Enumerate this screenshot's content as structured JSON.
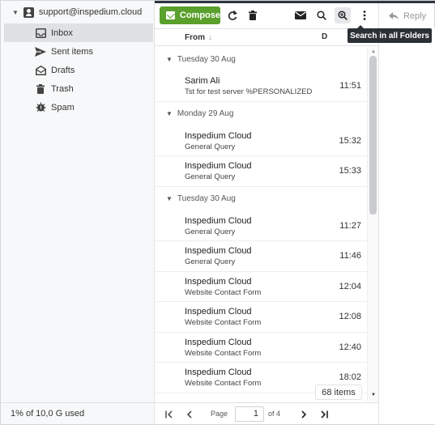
{
  "account": {
    "email": "support@inspedium.cloud"
  },
  "folders": [
    {
      "label": "Inbox",
      "icon": "inbox-icon",
      "active": true
    },
    {
      "label": "Sent items",
      "icon": "send-icon",
      "active": false
    },
    {
      "label": "Drafts",
      "icon": "drafts-icon",
      "active": false
    },
    {
      "label": "Trash",
      "icon": "trash-icon",
      "active": false
    },
    {
      "label": "Spam",
      "icon": "spam-icon",
      "active": false
    }
  ],
  "quota": "1% of 10,0 G used",
  "toolbar": {
    "compose_label": "Compose",
    "reply_label": "Reply",
    "tooltip": "Search in all Folders"
  },
  "list": {
    "from_header": "From",
    "sort_arrow": "↓",
    "date_header": "D",
    "groups": [
      {
        "label": "Tuesday 30 Aug",
        "messages": [
          {
            "from": "Sarim Ali",
            "subject": "Tst for test server %PERSONALIZED",
            "time": "11:51"
          }
        ]
      },
      {
        "label": "Monday 29 Aug",
        "messages": [
          {
            "from": "Inspedium Cloud",
            "subject": "General Query",
            "time": "15:32"
          },
          {
            "from": "Inspedium Cloud",
            "subject": "General Query",
            "time": "15:33"
          }
        ]
      },
      {
        "label": "Tuesday 30 Aug",
        "messages": [
          {
            "from": "Inspedium Cloud",
            "subject": "General Query",
            "time": "11:27"
          },
          {
            "from": "Inspedium Cloud",
            "subject": "General Query",
            "time": "11:46"
          },
          {
            "from": "Inspedium Cloud",
            "subject": "Website Contact Form",
            "time": "12:04"
          },
          {
            "from": "Inspedium Cloud",
            "subject": "Website Contact Form",
            "time": "12:08"
          },
          {
            "from": "Inspedium Cloud",
            "subject": "Website Contact Form",
            "time": "12:40"
          },
          {
            "from": "Inspedium Cloud",
            "subject": "Website Contact Form",
            "time": "18:02"
          }
        ]
      }
    ],
    "item_count": "68 items"
  },
  "pager": {
    "page_label": "Page",
    "page": "1",
    "of_label": "of 4"
  },
  "colors": {
    "compose": "#5aa02c",
    "tooltip_bg": "#2b2f36",
    "active_folder": "#dfe1e4"
  }
}
